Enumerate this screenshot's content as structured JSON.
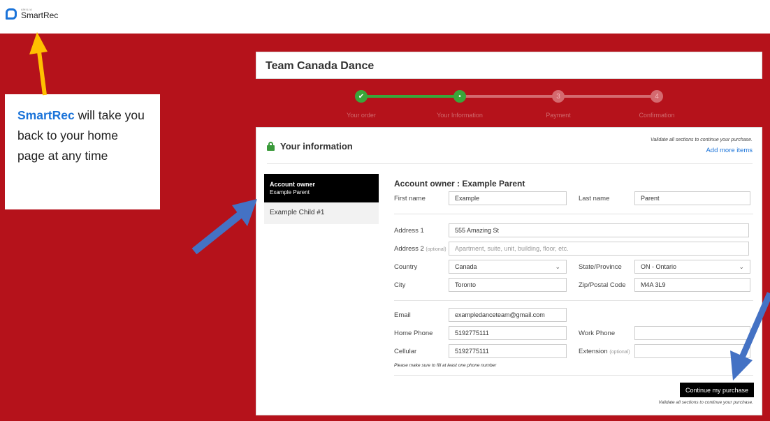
{
  "brand": {
    "small": "AMILIA",
    "name": "SmartRec"
  },
  "program": {
    "title": "Team Canada Dance"
  },
  "stepper": {
    "steps": [
      {
        "label": "Your order",
        "marker": "✔"
      },
      {
        "label": "Your Information",
        "marker": "•"
      },
      {
        "label": "Payment",
        "marker": "3"
      },
      {
        "label": "Confirmation",
        "marker": "4"
      }
    ]
  },
  "card": {
    "title": "Your information",
    "validate_note": "Validate all sections to continue your purchase.",
    "add_more": "Add more items"
  },
  "sidebar": {
    "active": {
      "title": "Account owner",
      "subtitle": "Example Parent"
    },
    "items": [
      {
        "label": "Example Child #1"
      }
    ]
  },
  "form": {
    "title": "Account owner : Example Parent",
    "first_name": {
      "label": "First name",
      "value": "Example"
    },
    "last_name": {
      "label": "Last name",
      "value": "Parent"
    },
    "address1": {
      "label": "Address 1",
      "value": "555 Amazing St"
    },
    "address2": {
      "label": "Address 2",
      "optional": "(optional)",
      "placeholder": "Apartment, suite, unit, building, floor, etc."
    },
    "country": {
      "label": "Country",
      "value": "Canada"
    },
    "state": {
      "label": "State/Province",
      "value": "ON - Ontario"
    },
    "city": {
      "label": "City",
      "value": "Toronto"
    },
    "zip": {
      "label": "Zip/Postal Code",
      "value": "M4A 3L9"
    },
    "email": {
      "label": "Email",
      "value": "exampledanceteam@gmail.com"
    },
    "home_phone": {
      "label": "Home Phone",
      "value": "5192775111"
    },
    "work_phone": {
      "label": "Work Phone",
      "value": ""
    },
    "cellular": {
      "label": "Cellular",
      "value": "5192775111"
    },
    "extension": {
      "label": "Extension",
      "optional": "(optional)",
      "value": ""
    },
    "phone_note": "Please make sure to fill at least one phone number"
  },
  "actions": {
    "continue_label": "Continue my purchase",
    "validate_note": "Validate all sections to continue your purchase."
  },
  "callout": {
    "brand": "SmartRec",
    "rest": " will take you back to your home page at any time"
  },
  "colors": {
    "background": "#b5121b",
    "accent": "#1a73d9",
    "step_complete": "#3aa63a",
    "arrow_blue": "#4472c4",
    "arrow_yellow": "#ffc000"
  }
}
